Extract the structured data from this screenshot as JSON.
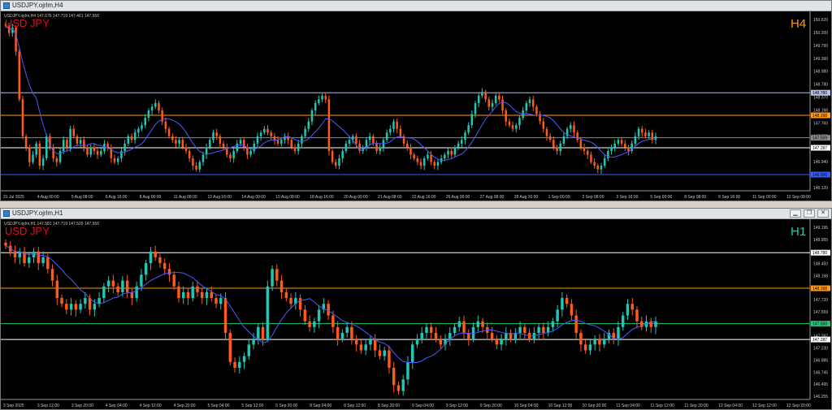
{
  "panels": [
    {
      "id": "h4",
      "window_title": "USDJPY.ojrlm,H4",
      "info_line": "USDJPY.ojrlm,H4  147.676 147.719 147.461 147.559",
      "symbol_label": "USD JPY",
      "timeframe_label": "H4",
      "timeframe_color": "#ff9a1a",
      "price_ticks": [
        "150.620",
        "150.200",
        "149.790",
        "149.390",
        "148.980",
        "148.780",
        "148.370",
        "148.168",
        "147.760",
        "147.559",
        "147.287",
        "146.940",
        "146.560",
        "146.120"
      ],
      "time_ticks": [
        "31 Jul 2025",
        "4 Aug 00:00",
        "5 Aug 08:00",
        "6 Aug 16:00",
        "8 Aug 00:00",
        "11 Aug 08:00",
        "12 Aug 16:00",
        "14 Aug 00:00",
        "15 Aug 08:00",
        "18 Aug 16:00",
        "20 Aug 00:00",
        "21 Aug 08:00",
        "22 Aug 16:00",
        "26 Aug 00:00",
        "27 Aug 08:00",
        "28 Aug 16:00",
        "1 Sep 00:00",
        "2 Sep 08:00",
        "3 Sep 16:00",
        "5 Sep 00:00",
        "8 Sep 08:00",
        "9 Sep 16:00",
        "11 Sep 00:00",
        "12 Sep 08:00"
      ],
      "levels": [
        {
          "price": 148.78,
          "color": "#b8c0e8",
          "label": "148.780"
        },
        {
          "price": 148.168,
          "color": "#ff9a1a",
          "label": "148.168"
        },
        {
          "price": 147.559,
          "color": "#888888",
          "label": "147.559"
        },
        {
          "price": 147.287,
          "color": "#ffffff",
          "label": "147.287"
        },
        {
          "price": 146.56,
          "color": "#3a5cff",
          "label": "146.560"
        }
      ],
      "ma_color": "#4a5cff",
      "bull_color": "#1ec8b4",
      "bear_color": "#ff5a1a"
    },
    {
      "id": "h1",
      "window_title": "USDJPY.ojrlm,H1",
      "info_line": "USDJPY.ojrlm,H1  147.581 147.719 147.539 147.559",
      "symbol_label": "USD JPY",
      "timeframe_label": "H1",
      "timeframe_color": "#1ec8b4",
      "price_ticks": [
        "149.195",
        "148.955",
        "148.780",
        "148.450",
        "148.168",
        "147.965",
        "147.720",
        "147.559",
        "147.475",
        "147.287",
        "147.230",
        "146.985",
        "146.745",
        "146.495",
        "146.255"
      ],
      "time_ticks": [
        "3 Sep 2025",
        "3 Sep 12:00",
        "3 Sep 20:00",
        "4 Sep 04:00",
        "4 Sep 12:00",
        "4 Sep 20:00",
        "5 Sep 04:00",
        "5 Sep 12:00",
        "5 Sep 20:00",
        "8 Sep 04:00",
        "8 Sep 12:00",
        "8 Sep 20:00",
        "9 Sep 04:00",
        "9 Sep 12:00",
        "9 Sep 20:00",
        "10 Sep 04:00",
        "10 Sep 12:00",
        "10 Sep 20:00",
        "11 Sep 04:00",
        "11 Sep 12:00",
        "11 Sep 20:00",
        "12 Sep 04:00",
        "12 Sep 12:00",
        "12 Sep 20:00"
      ],
      "levels": [
        {
          "price": 148.78,
          "color": "#ffffff",
          "label": "148.780"
        },
        {
          "price": 148.168,
          "color": "#ff9a1a",
          "label": "148.168"
        },
        {
          "price": 147.559,
          "color": "#1ec878",
          "label": "147.559"
        },
        {
          "price": 147.287,
          "color": "#ffffff",
          "label": "147.287"
        }
      ],
      "ma_color": "#4a5cff",
      "bull_color": "#1ec8b4",
      "bear_color": "#ff5a1a"
    }
  ],
  "chart_data": [
    {
      "type": "candlestick",
      "title": "USD JPY",
      "timeframe": "H4",
      "ylim": [
        146.12,
        150.9
      ],
      "closes": [
        150.6,
        150.4,
        150.55,
        149.9,
        148.6,
        147.6,
        147.3,
        146.9,
        147.1,
        147.4,
        146.8,
        147.0,
        147.6,
        147.3,
        147.0,
        146.9,
        147.2,
        147.5,
        147.3,
        147.8,
        147.6,
        147.4,
        147.5,
        147.3,
        147.1,
        147.3,
        147.2,
        147.1,
        147.2,
        147.4,
        147.3,
        147.0,
        146.9,
        147.0,
        147.2,
        147.4,
        147.6,
        147.5,
        147.7,
        147.8,
        147.9,
        148.1,
        148.3,
        148.4,
        148.5,
        148.3,
        148.0,
        147.8,
        147.6,
        147.5,
        147.4,
        147.5,
        147.3,
        147.2,
        147.0,
        146.8,
        146.7,
        146.9,
        147.1,
        147.3,
        147.5,
        147.7,
        147.6,
        147.4,
        147.3,
        147.1,
        147.0,
        147.2,
        147.4,
        147.5,
        147.3,
        147.1,
        147.2,
        147.4,
        147.6,
        147.7,
        147.8,
        147.7,
        147.6,
        147.5,
        147.4,
        147.5,
        147.6,
        147.5,
        147.3,
        147.2,
        147.4,
        147.6,
        147.8,
        148.0,
        148.3,
        148.5,
        148.6,
        148.7,
        148.6,
        147.2,
        146.9,
        146.8,
        147.0,
        147.2,
        147.4,
        147.5,
        147.6,
        147.4,
        147.2,
        147.3,
        147.5,
        147.6,
        147.4,
        147.2,
        147.3,
        147.5,
        147.7,
        147.8,
        148.0,
        147.8,
        147.6,
        147.4,
        147.3,
        147.1,
        147.0,
        146.9,
        146.8,
        147.0,
        147.1,
        146.9,
        146.8,
        146.9,
        147.0,
        147.1,
        147.2,
        147.1,
        147.3,
        147.4,
        147.5,
        147.7,
        147.9,
        148.2,
        148.5,
        148.7,
        148.8,
        148.6,
        148.4,
        148.5,
        148.7,
        148.6,
        148.3,
        148.0,
        147.9,
        147.8,
        147.9,
        148.1,
        148.3,
        148.5,
        148.6,
        148.4,
        148.2,
        148.0,
        147.8,
        147.6,
        147.5,
        147.3,
        147.2,
        147.4,
        147.6,
        147.8,
        147.9,
        147.7,
        147.5,
        147.3,
        147.2,
        147.1,
        146.9,
        146.8,
        146.7,
        146.8,
        147.0,
        147.2,
        147.3,
        147.4,
        147.5,
        147.4,
        147.3,
        147.2,
        147.4,
        147.6,
        147.8,
        147.7,
        147.6,
        147.7,
        147.5,
        147.6
      ],
      "ma": "moving average (blue)",
      "horizontal_levels": [
        148.78,
        148.168,
        147.559,
        147.287,
        146.56
      ]
    },
    {
      "type": "candlestick",
      "title": "USD JPY",
      "timeframe": "H1",
      "ylim": [
        146.255,
        149.3
      ],
      "closes": [
        148.9,
        148.8,
        148.7,
        148.8,
        148.6,
        148.7,
        148.8,
        148.6,
        148.7,
        148.5,
        148.3,
        148.0,
        147.9,
        147.8,
        147.9,
        147.8,
        147.9,
        148.0,
        147.8,
        147.9,
        148.0,
        148.2,
        148.3,
        148.2,
        148.1,
        148.3,
        148.1,
        148.0,
        148.2,
        148.4,
        148.6,
        148.8,
        148.7,
        148.6,
        148.5,
        148.4,
        148.2,
        148.0,
        148.1,
        148.0,
        148.2,
        148.1,
        148.0,
        148.1,
        148.0,
        147.9,
        148.0,
        147.4,
        146.9,
        146.8,
        146.9,
        147.0,
        147.2,
        147.3,
        147.5,
        147.3,
        148.2,
        148.5,
        148.3,
        148.1,
        148.0,
        147.9,
        148.0,
        147.8,
        147.6,
        147.5,
        147.6,
        147.8,
        147.9,
        147.7,
        147.5,
        147.3,
        147.4,
        147.5,
        147.3,
        147.2,
        147.1,
        147.2,
        147.3,
        147.1,
        147.0,
        147.1,
        146.8,
        146.5,
        146.4,
        146.6,
        146.9,
        147.2,
        147.3,
        147.4,
        147.5,
        147.4,
        147.3,
        147.2,
        147.3,
        147.4,
        147.5,
        147.6,
        147.4,
        147.3,
        147.5,
        147.6,
        147.5,
        147.4,
        147.3,
        147.2,
        147.3,
        147.4,
        147.3,
        147.4,
        147.5,
        147.4,
        147.3,
        147.4,
        147.5,
        147.4,
        147.5,
        147.6,
        147.8,
        148.0,
        147.9,
        147.7,
        147.4,
        147.2,
        147.1,
        147.2,
        147.3,
        147.2,
        147.3,
        147.4,
        147.3,
        147.5,
        147.7,
        147.9,
        147.8,
        147.6,
        147.5,
        147.6,
        147.5,
        147.6
      ],
      "ma": "moving average (blue)",
      "horizontal_levels": [
        148.78,
        148.168,
        147.559,
        147.287
      ]
    }
  ]
}
